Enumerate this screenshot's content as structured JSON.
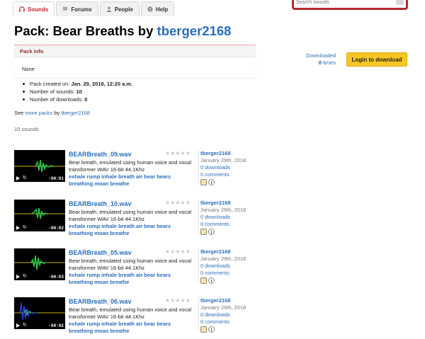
{
  "nav": {
    "tabs": [
      {
        "label": "Sounds",
        "active": true,
        "icon": "headphones-icon"
      },
      {
        "label": "Forums",
        "active": false,
        "icon": "speech-bubble-icon"
      },
      {
        "label": "People",
        "active": false,
        "icon": "person-icon"
      },
      {
        "label": "Help",
        "active": false,
        "icon": "question-icon"
      }
    ],
    "search_placeholder": "Search sounds"
  },
  "heading": {
    "prefix": "Pack: Bear Breaths by",
    "user": "tberger2168"
  },
  "pack_info": {
    "title": "Pack info",
    "description": "None",
    "stats": [
      {
        "label": "Pack created on:",
        "value": "Jan. 29, 2018, 12:20 a.m."
      },
      {
        "label": "Number of sounds:",
        "value": "10"
      },
      {
        "label": "Number of downloads:",
        "value": "0"
      }
    ]
  },
  "see_more": {
    "prefix": "See",
    "link": "more packs",
    "middle": "by",
    "user": "tberger2168"
  },
  "sound_count": "10 sounds",
  "downloaded": {
    "label": "Downloaded",
    "count": "0",
    "unit": "times"
  },
  "login_button": "Login to download",
  "colors": {
    "accent": "#c2232c",
    "link": "#2a6ebb",
    "button": "#f7c624",
    "wave_green": "#29c94a",
    "wave_yellow": "#c9b21a",
    "wave_blue": "#2b3fd6"
  },
  "sounds": [
    {
      "name": "BEARBreath_09.wav",
      "description": "Bear breath, emulated using human voice and vocal transformer WAV 16-bit 44.1Khz",
      "tags": "exhale rump inhale breath air bear bears breathing moan breathe",
      "user": "tberger2168",
      "date": "January 29th, 2018",
      "downloads": "0 downloads",
      "comments": "0 comments",
      "duration": "-00:01"
    },
    {
      "name": "BEARBreath_10.wav",
      "description": "Bear breath, emulated using human voice and vocal transformer WAV 16-bit 44.1Khz",
      "tags": "exhale rump inhale breath air bear bears breathing moan breathe",
      "user": "tberger2168",
      "date": "January 29th, 2018",
      "downloads": "0 downloads",
      "comments": "0 comments",
      "duration": "-00:02"
    },
    {
      "name": "BEARBreath_05.wav",
      "description": "Bear breath, emulated using human voice and vocal transformer WAV 16-bit 44.1Khz",
      "tags": "exhale rump inhale breath air bear bears breathing moan breathe",
      "user": "tberger2168",
      "date": "January 29th, 2018",
      "downloads": "0 downloads",
      "comments": "0 comments",
      "duration": "-00:03"
    },
    {
      "name": "BEARBreath_06.wav",
      "description": "Bear breath, emulated using human voice and vocal transformer WAV 16-bit 44.1Khz",
      "tags": "exhale rump inhale breath air bear bears breathing moan breathe",
      "user": "tberger2168",
      "date": "January 29th, 2018",
      "downloads": "0 downloads",
      "comments": "0 comments",
      "duration": "-00:02"
    }
  ]
}
